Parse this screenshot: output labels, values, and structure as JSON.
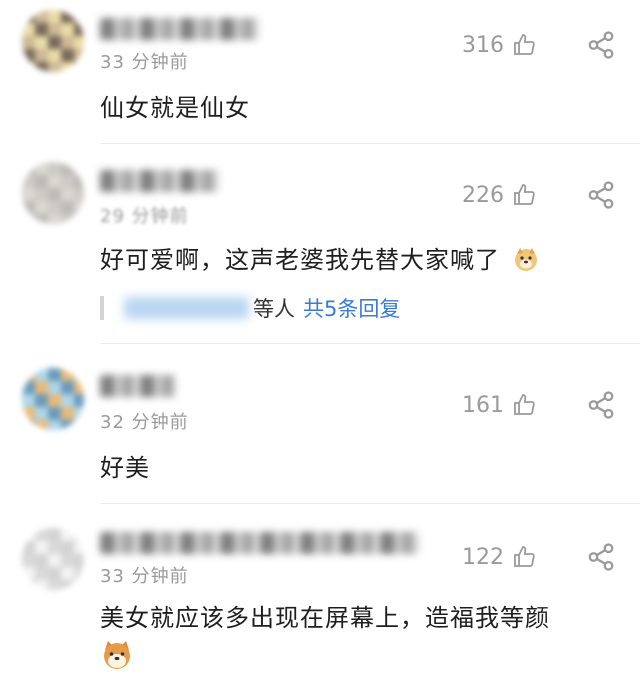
{
  "comments": [
    {
      "time": "33 分钟前",
      "likes": "316",
      "text": "仙女就是仙女",
      "avatar_colors": [
        "#6b5a4a",
        "#a8a39b",
        "#c9b28a",
        "#8b7e70",
        "#e8d9a0",
        "#d6c48e"
      ]
    },
    {
      "time": "29 分钟前",
      "likes": "226",
      "text": "好可爱啊，这声老婆我先替大家喊了",
      "emoji": "doge-emoji",
      "reply": {
        "others": "等人",
        "count": "共5条回复"
      },
      "avatar_colors": [
        "#b7b4b0",
        "#e9e6e1",
        "#d7d3cc",
        "#f0e9d3",
        "#c9c5bf",
        "#eadca0"
      ]
    },
    {
      "time": "32 分钟前",
      "likes": "161",
      "text": "好美",
      "avatar_colors": [
        "#e8b36a",
        "#7fb9d9",
        "#a6d3ea",
        "#f0f6fa",
        "#5a90b5",
        "#c8e4f2"
      ]
    },
    {
      "time": "33 分钟前",
      "likes": "122",
      "text": "美女就应该多出现在屏幕上，造福我等颜",
      "emoji": "shiba-emoji",
      "avatar_colors": [
        "#f2f2f2",
        "#e3e3e3",
        "#d5d5d5",
        "#ededed",
        "#cfcfcf",
        "#e9e9e9"
      ]
    }
  ],
  "colors": {
    "meta": "#9a9a9a",
    "link": "#3a7ad8",
    "text": "#1e1e1e"
  }
}
